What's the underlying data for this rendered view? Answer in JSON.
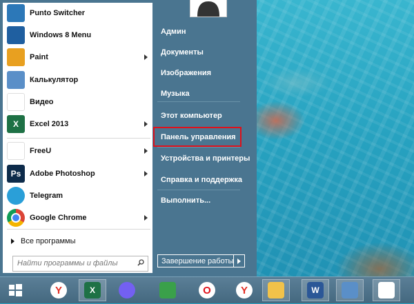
{
  "programs": [
    {
      "label": "Punto Switcher",
      "icon": "punto-switcher-icon",
      "glyph": "",
      "color": "#2c78b8",
      "submenu": false
    },
    {
      "label": "Windows 8 Menu",
      "icon": "windows8-menu-icon",
      "glyph": "",
      "color": "#1f5fa0",
      "submenu": false
    },
    {
      "label": "Paint",
      "icon": "paint-icon",
      "glyph": "",
      "color": "#e8a020",
      "submenu": true
    },
    {
      "label": "Калькулятор",
      "icon": "calculator-icon",
      "glyph": "",
      "color": "#5a8fc8",
      "submenu": false
    },
    {
      "label": "Видео",
      "icon": "video-icon",
      "glyph": "",
      "color": "#ffffff",
      "submenu": false
    },
    {
      "label": "Excel 2013",
      "icon": "excel-icon",
      "glyph": "X",
      "color": "#1e7145",
      "submenu": true
    },
    {
      "label": "FreeU",
      "icon": "freeu-icon",
      "glyph": "",
      "color": "#ffffff",
      "submenu": true
    },
    {
      "label": "Adobe Photoshop",
      "icon": "photoshop-icon",
      "glyph": "Ps",
      "color": "#0d2b4a",
      "submenu": true
    },
    {
      "label": "Telegram",
      "icon": "telegram-icon",
      "glyph": "",
      "color": "#2a9fd8",
      "submenu": false
    },
    {
      "label": "Google Chrome",
      "icon": "chrome-icon",
      "glyph": "",
      "color": "#ffffff",
      "submenu": true
    }
  ],
  "all_programs": "Все программы",
  "search": {
    "placeholder": "Найти программы и файлы"
  },
  "right_pane": {
    "items": [
      {
        "label": "Админ",
        "name": "right-item-admin"
      },
      {
        "label": "Документы",
        "name": "right-item-documents"
      },
      {
        "label": "Изображения",
        "name": "right-item-pictures"
      },
      {
        "label": "Музыка",
        "name": "right-item-music"
      },
      {
        "label": "Этот компьютер",
        "name": "right-item-this-pc"
      },
      {
        "label": "Панель управления",
        "name": "right-item-control-panel"
      },
      {
        "label": "Устройства и принтеры",
        "name": "right-item-devices-printers"
      },
      {
        "label": "Справка и поддержка",
        "name": "right-item-help-support"
      },
      {
        "label": "Выполнить...",
        "name": "right-item-run"
      }
    ],
    "highlighted": "Панель управления",
    "highlight_color": "#e0101a"
  },
  "shutdown": {
    "label": "Завершение работы"
  },
  "taskbar": {
    "items": [
      {
        "icon": "yandex-browser-icon",
        "glyph": "Y",
        "color": "#e22b22",
        "active": false
      },
      {
        "icon": "excel-taskbar-icon",
        "glyph": "X",
        "color": "#1e7145",
        "active": true
      },
      {
        "icon": "viber-icon",
        "glyph": "",
        "color": "#7360f2",
        "active": false
      },
      {
        "icon": "excel-alt-icon",
        "glyph": "",
        "color": "#3aa04a",
        "active": false
      },
      {
        "icon": "opera-icon",
        "glyph": "O",
        "color": "#e0101a",
        "active": false
      },
      {
        "icon": "yandex-user-icon",
        "glyph": "Y",
        "color": "#e22b22",
        "active": false
      },
      {
        "icon": "file-explorer-icon",
        "glyph": "",
        "color": "#f1c24a",
        "active": true
      },
      {
        "icon": "word-icon",
        "glyph": "W",
        "color": "#2b5797",
        "active": true
      },
      {
        "icon": "calculator-taskbar-icon",
        "glyph": "",
        "color": "#5a8fc8",
        "active": true
      },
      {
        "icon": "freeu-taskbar-icon",
        "glyph": "",
        "color": "#ffffff",
        "active": true
      }
    ]
  }
}
